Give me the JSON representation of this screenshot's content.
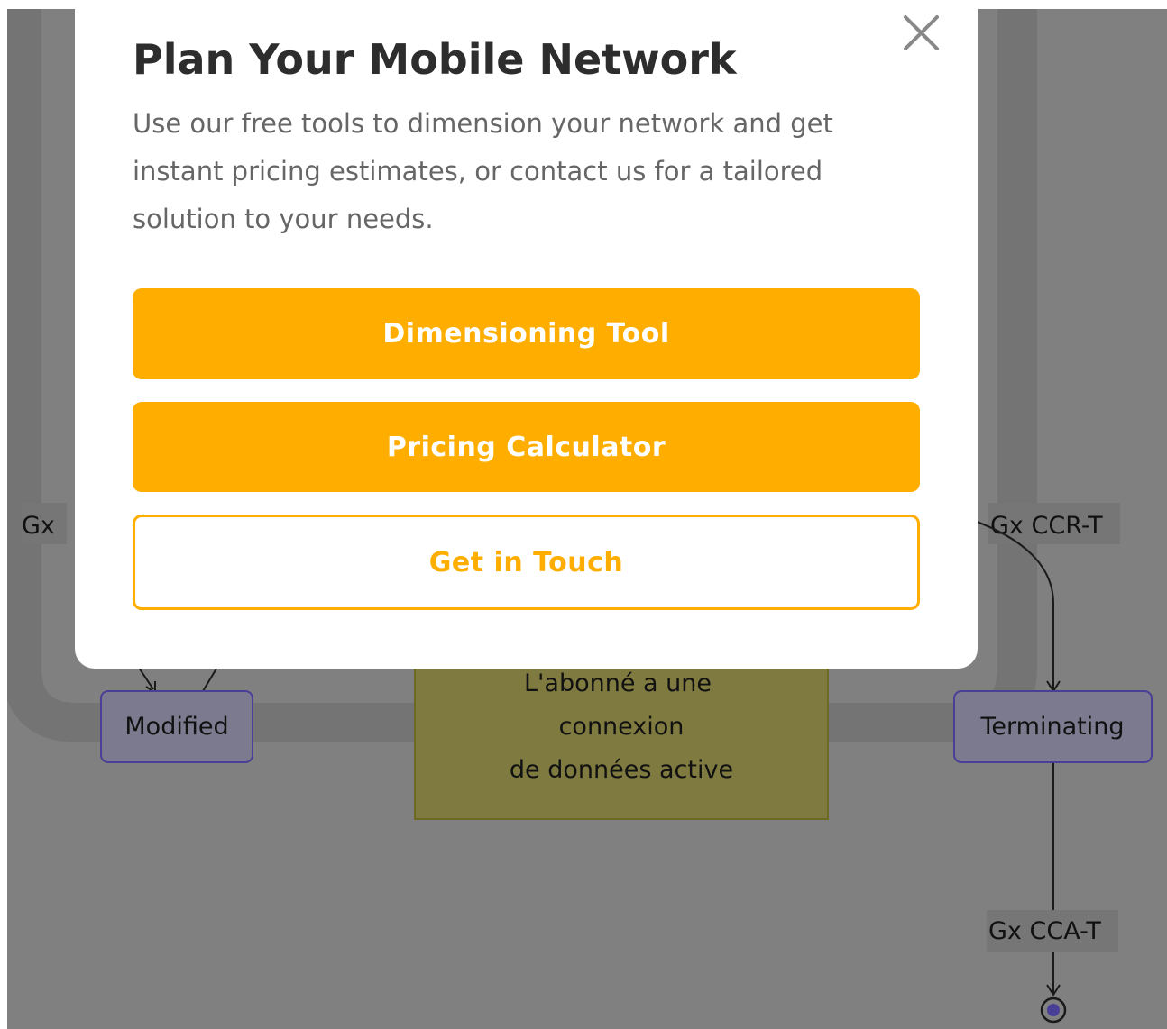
{
  "modal": {
    "title": "Plan Your Mobile Network",
    "description": "Use our free tools to dimension your network and get instant pricing estimates, or contact us for a tailored solution to your needs.",
    "buttons": {
      "dimensioning": "Dimensioning Tool",
      "pricing": "Pricing Calculator",
      "contact": "Get in Touch"
    },
    "close_icon": "close-icon"
  },
  "diagram": {
    "labels": {
      "gx_left": "Gx",
      "gx_ccr_t": "Gx CCR-T",
      "gx_cca_t": "Gx CCA-T"
    },
    "states": {
      "modified": "Modified",
      "terminating": "Terminating"
    },
    "note": {
      "line1": "L'abonné a une",
      "line2": "connexion",
      "line3": "de données active"
    }
  },
  "colors": {
    "overlay": "#808080",
    "accent": "#ffae00",
    "state_fill": "#7b7a8f",
    "state_border": "#4a3f96",
    "note_fill": "#7f7a40",
    "note_border": "#6c6a22"
  }
}
